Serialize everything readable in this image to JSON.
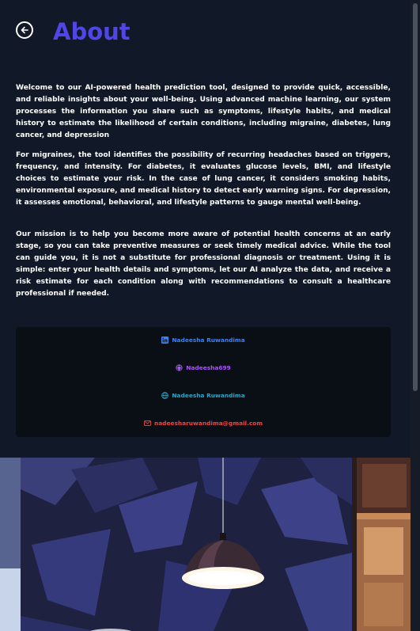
{
  "header": {
    "title": "About"
  },
  "about": {
    "p1": "Welcome to our AI-powered health prediction tool, designed to provide quick, accessible, and reliable insights about your well-being. Using advanced machine learning, our system processes the information you share such as symptoms, lifestyle habits, and medical history to estimate the likelihood of certain conditions, including migraine, diabetes, lung cancer, and depression",
    "p2": "For migraines, the tool identifies the possibility of recurring headaches based on triggers, frequency, and intensity. For diabetes, it evaluates glucose levels, BMI, and lifestyle choices to estimate your risk. In the case of lung cancer, it considers smoking habits, environmental exposure, and medical history to detect early warning signs. For depression, it assesses emotional, behavioral, and lifestyle patterns to gauge mental well-being.",
    "p3": "Our mission is to help you become more aware of potential health concerns at an early stage, so you can take preventive measures or seek timely medical advice. While the tool can guide you, it is not a substitute for professional diagnosis or treatment. Using it is simple: enter your health details and symptoms, let our AI analyze the data, and receive a risk estimate for each condition along with recommendations to consult a healthcare professional if needed."
  },
  "contact": {
    "linkedin": "Nadeesha Ruwandima",
    "github": "Nadeesha699",
    "website": "Nadeesha Ruwandima",
    "email": "nadeesharuwandima@gmail.com"
  },
  "colors": {
    "accent": "#4f46e5",
    "linkedin": "#3b82f6",
    "github": "#a855f7",
    "website": "#22a9c9",
    "email": "#ef4444",
    "background": "#111827",
    "card": "#0a0f16"
  },
  "icons": [
    "back-arrow-icon",
    "linkedin-icon",
    "github-icon",
    "globe-icon",
    "mail-icon"
  ]
}
